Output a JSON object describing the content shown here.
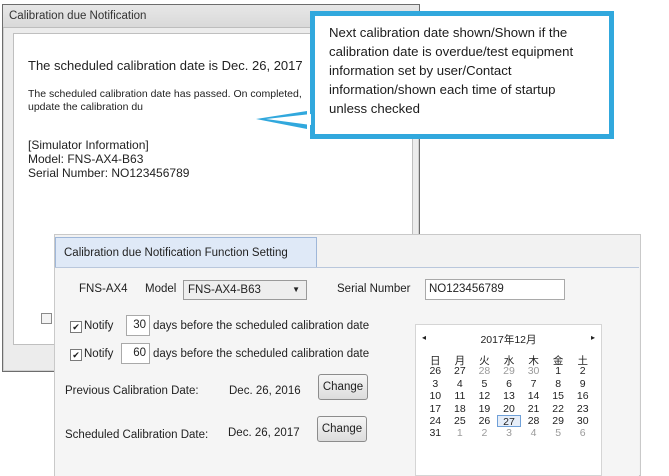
{
  "notification_window": {
    "title": "Calibration due Notification",
    "message_main": "The scheduled calibration date is Dec. 26, 2017",
    "message_sub": "The scheduled calibration date has passed. On completed, update the calibration du",
    "sim_header": "[Simulator Information]",
    "model_line": "Model: FNS-AX4-B63",
    "serial_line": "Serial Number: NO123456789"
  },
  "callout": {
    "text": "Next calibration date shown/Shown if the calibration date is overdue/test equipment information set by user/Contact information/shown each time of startup unless checked"
  },
  "settings": {
    "tab_label": "Calibration due Notification Function Setting",
    "device_label": "FNS-AX4",
    "model_label": "Model",
    "model_value": "FNS-AX4-B63",
    "serial_label": "Serial Number",
    "serial_value": "NO123456789",
    "notify": [
      {
        "checked": true,
        "label": "Notify",
        "days": "30",
        "suffix": "days before the scheduled calibration date"
      },
      {
        "checked": true,
        "label": "Notify",
        "days": "60",
        "suffix": "days before the scheduled calibration date"
      }
    ],
    "previous": {
      "label": "Previous Calibration Date:",
      "date": "Dec. 26, 2016",
      "button": "Change"
    },
    "scheduled": {
      "label": "Scheduled Calibration Date:",
      "date": "Dec. 26, 2017",
      "button": "Change"
    }
  },
  "calendar": {
    "title": "2017年12月",
    "prev_icon": "◂",
    "next_icon": "▸",
    "weekdays": [
      "日",
      "月",
      "火",
      "水",
      "木",
      "金",
      "土"
    ],
    "selected_day": "27",
    "weeks": [
      [
        "26",
        "27",
        "28",
        "29",
        "30",
        "1",
        "2"
      ],
      [
        "3",
        "4",
        "5",
        "6",
        "7",
        "8",
        "9"
      ],
      [
        "10",
        "11",
        "12",
        "13",
        "14",
        "15",
        "16"
      ],
      [
        "17",
        "18",
        "19",
        "20",
        "21",
        "22",
        "23"
      ],
      [
        "24",
        "25",
        "26",
        "27",
        "28",
        "29",
        "30"
      ],
      [
        "31",
        "1",
        "2",
        "3",
        "4",
        "5",
        "6"
      ]
    ],
    "other_month_rows": [
      [
        0,
        0,
        1,
        1,
        1,
        0,
        0
      ],
      [
        0,
        0,
        0,
        0,
        0,
        0,
        0
      ],
      [
        0,
        0,
        0,
        0,
        0,
        0,
        0
      ],
      [
        0,
        0,
        0,
        0,
        0,
        0,
        0
      ],
      [
        0,
        0,
        0,
        0,
        0,
        0,
        0
      ],
      [
        0,
        1,
        1,
        1,
        1,
        1,
        1
      ]
    ]
  },
  "colors": {
    "callout_border": "#31a8dd",
    "tab_bg": "#dfe9f7"
  }
}
